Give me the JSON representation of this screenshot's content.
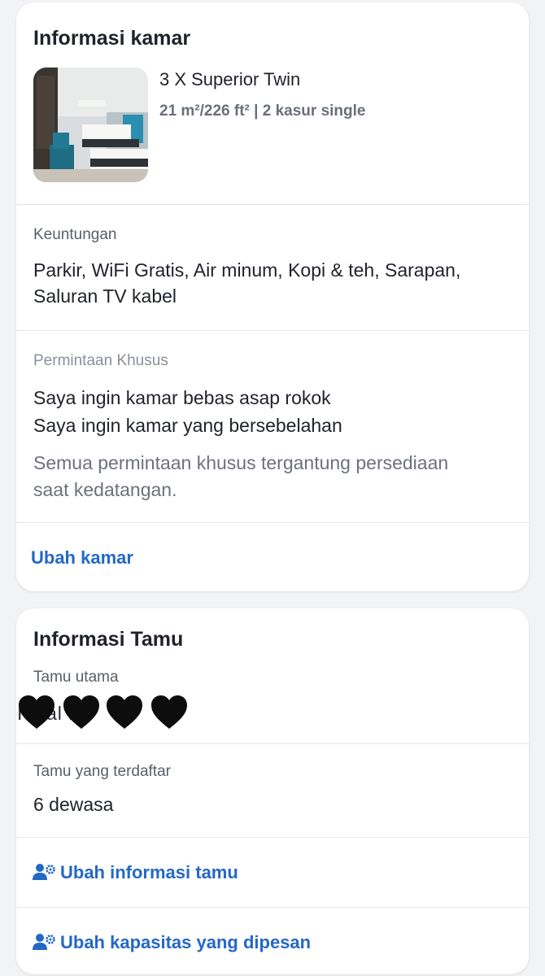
{
  "room_info": {
    "title": "Informasi kamar",
    "room_name": "3 X Superior Twin",
    "room_spec": "21 m²/226 ft² | 2 kasur single",
    "benefits_label": "Keuntungan",
    "benefits_line1": "Parkir, WiFi Gratis, Air minum, Kopi & teh, Sarapan,",
    "benefits_line2": "Saluran TV kabel",
    "special_requests_label": "Permintaan Khusus",
    "special_requests": [
      "Saya ingin kamar bebas asap rokok",
      "Saya ingin kamar yang bersebelahan"
    ],
    "special_note_line1": "Semua permintaan khusus tergantung persediaan",
    "special_note_line2": "saat kedatangan.",
    "change_room_link": "Ubah kamar"
  },
  "guest_info": {
    "title": "Informasi Tamu",
    "main_guest_label": "Tamu utama",
    "main_guest_obscured": "I  A    al   r",
    "registered_label": "Tamu yang terdaftar",
    "registered_value": "6 dewasa",
    "edit_guest_link": "Ubah informasi tamu",
    "edit_capacity_link": "Ubah kapasitas yang dipesan"
  },
  "icons": {
    "heart": "black-heart-icon",
    "edit_guest": "user-gear-icon",
    "edit_capacity": "user-gear-icon"
  },
  "colors": {
    "link": "#2468c5",
    "title": "#1f2229",
    "muted": "#6d717a",
    "divider": "#e3e5e9",
    "background": "#f2f3f5"
  }
}
